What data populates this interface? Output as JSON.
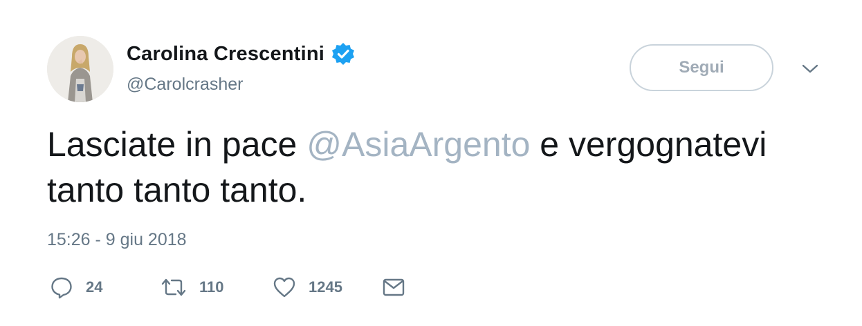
{
  "user": {
    "display_name": "Carolina Crescentini",
    "handle": "@Carolcrasher",
    "verified": true,
    "avatar_icon": "profile-photo",
    "verified_icon": "verified-badge-icon"
  },
  "follow_button": {
    "label": "Segui"
  },
  "menu": {
    "icon": "chevron-down-icon"
  },
  "tweet": {
    "text_before": "Lasciate in pace ",
    "mention": "@AsiaArgento",
    "text_after": " e vergognatevi tanto tanto tanto.",
    "timestamp": "15:26 - 9 giu 2018"
  },
  "actions": {
    "reply": {
      "icon": "reply-icon",
      "count": "24"
    },
    "retweet": {
      "icon": "retweet-icon",
      "count": "110"
    },
    "like": {
      "icon": "heart-icon",
      "count": "1245"
    },
    "message": {
      "icon": "envelope-icon"
    }
  },
  "colors": {
    "text": "#14171a",
    "secondary": "#657786",
    "mention": "#a4b4c3",
    "verified": "#1da1f2",
    "button_border": "#c9d3db"
  }
}
